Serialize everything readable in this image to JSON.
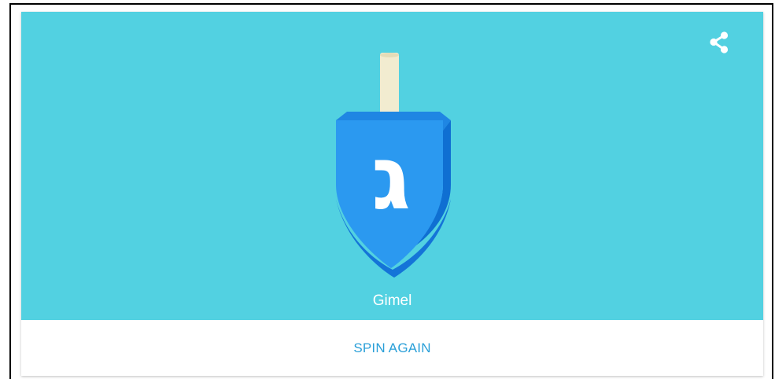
{
  "colors": {
    "stage_background": "#52d1e1",
    "accent": "#2a9fd8",
    "dreidel_face": "#2b99f0",
    "dreidel_top": "#1f86e3",
    "dreidel_edge": "#0f6fd2",
    "dreidel_handle": "#f2ecd0",
    "label_text": "#ffffff",
    "card_background": "#ffffff"
  },
  "stage": {
    "share_icon": "share-icon",
    "dreidel": {
      "letter": "ג",
      "result_name": "Gimel"
    }
  },
  "actions": {
    "spin_again_label": "SPIN AGAIN"
  }
}
